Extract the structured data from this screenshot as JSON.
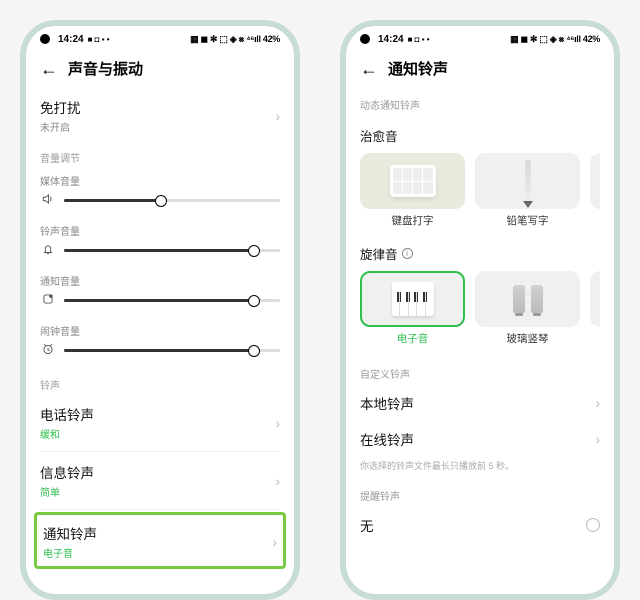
{
  "status": {
    "time": "14:24",
    "right_icons": "▦ ◼ ✻ ⬚ ◈ ⨳ ⁴⁶ıll 42%"
  },
  "phone1": {
    "title": "声音与振动",
    "dnd": {
      "label": "免打扰",
      "sub": "未开启"
    },
    "volume_section": "音量调节",
    "sliders": {
      "media": {
        "label": "媒体音量",
        "pct": 45
      },
      "ring": {
        "label": "铃声音量",
        "pct": 88
      },
      "notif": {
        "label": "通知音量",
        "pct": 88
      },
      "alarm": {
        "label": "闹钟音量",
        "pct": 88
      }
    },
    "ringtone_section": "铃声",
    "call": {
      "label": "电话铃声",
      "sub": "缓和"
    },
    "sms": {
      "label": "信息铃声",
      "sub": "简单"
    },
    "notif": {
      "label": "通知铃声",
      "sub": "电子音"
    }
  },
  "phone2": {
    "title": "通知铃声",
    "dynamic_section": "动态通知铃声",
    "healing_title": "治愈音",
    "healing_tiles": [
      {
        "cap": "键盘打字"
      },
      {
        "cap": "铅笔写字"
      }
    ],
    "melody_title": "旋律音",
    "melody_tiles": [
      {
        "cap": "电子音",
        "selected": true
      },
      {
        "cap": "玻璃竖琴"
      }
    ],
    "custom_section": "自定义铃声",
    "local": "本地铃声",
    "online": "在线铃声",
    "hint": "你选择的铃声文件最长只播放前 5 秒。",
    "remind_section": "提醒铃声",
    "none_label": "无"
  }
}
